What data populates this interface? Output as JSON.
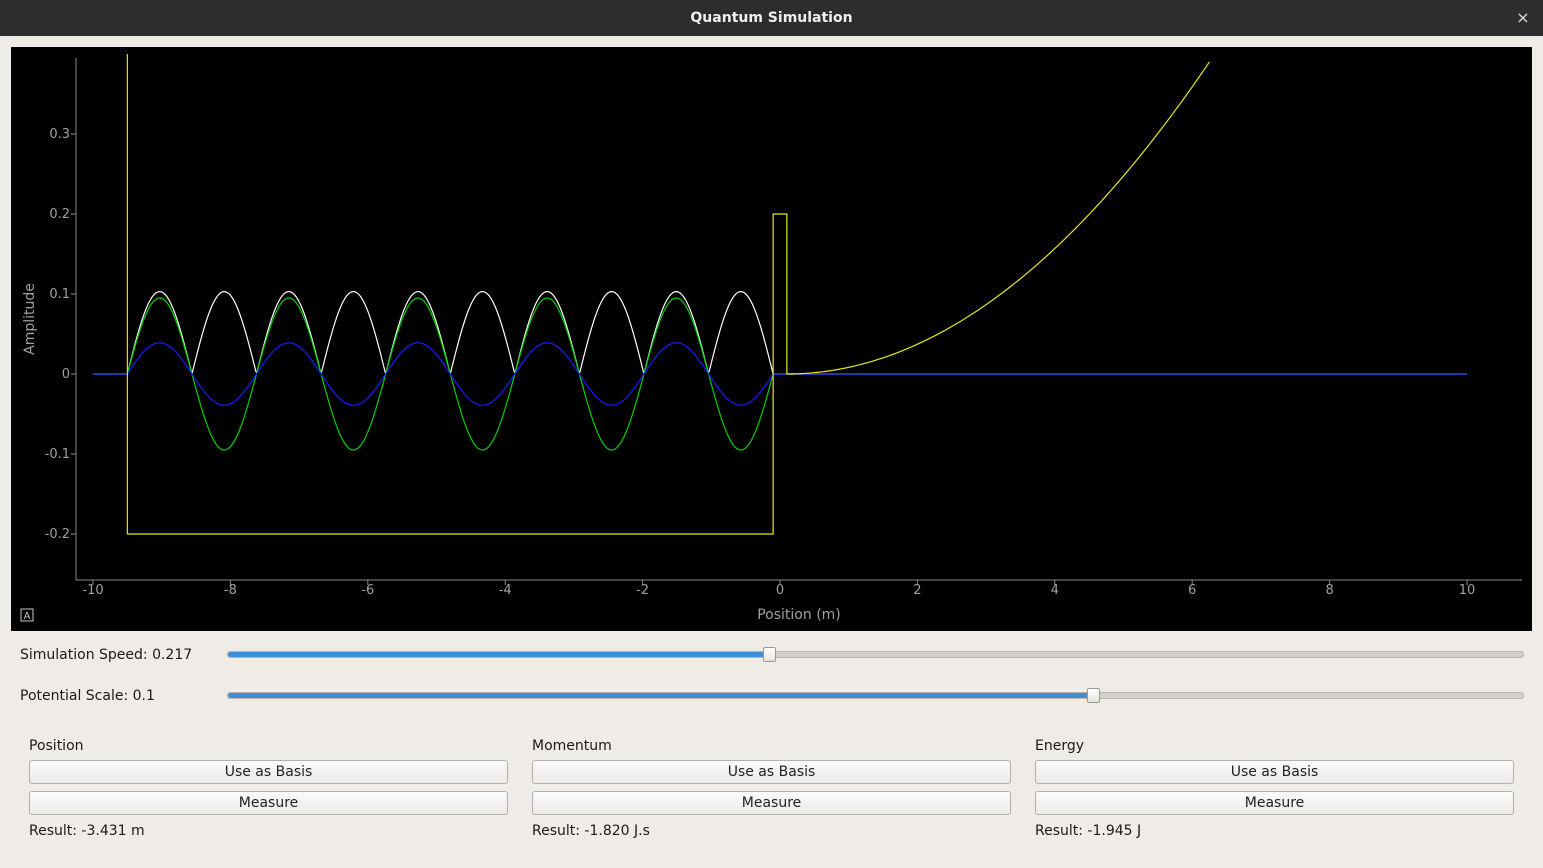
{
  "window": {
    "title": "Quantum Simulation",
    "close_glyph": "×"
  },
  "chart_data": {
    "type": "line",
    "xlabel": "Position (m)",
    "ylabel": "Amplitude",
    "xlim": [
      -10.5,
      11.5
    ],
    "ylim": [
      -0.26,
      0.4
    ],
    "xticks": [
      -10,
      -8,
      -6,
      -4,
      -2,
      0,
      2,
      4,
      6,
      8,
      10
    ],
    "xtick_labels": [
      "-10",
      "-8",
      "-6",
      "-4",
      "-2",
      "0",
      "2",
      "4",
      "6",
      "8",
      "10"
    ],
    "yticks": [
      -0.2,
      -0.1,
      0,
      0.1,
      0.2,
      0.3
    ],
    "ytick_labels": [
      "-0.2",
      "-0.1",
      "0",
      "0.1",
      "0.2",
      "0.3"
    ],
    "grid": false,
    "corner_button_label": "A",
    "series": [
      {
        "key": "magnitude",
        "color": "#ffffff",
        "wave_x_start": -9.5,
        "wave_x_end": -0.1,
        "wave_amplitude": 0.103,
        "wave_half_periods": 10,
        "data_x_start": -10,
        "data_x_end": 10,
        "y_after": 0
      },
      {
        "key": "real",
        "color": "#00d000",
        "wave_x_start": -9.5,
        "wave_x_end": -0.1,
        "wave_amplitude": 0.095,
        "wave_half_periods": 10,
        "data_x_start": -10,
        "data_x_end": 10,
        "y_after": 0,
        "note_sign": "alternating"
      },
      {
        "key": "imag",
        "color": "#1a1aff",
        "wave_x_start": -9.5,
        "wave_x_end": -0.1,
        "wave_amplitude": 0.039,
        "wave_half_periods": 10,
        "data_x_start": -10,
        "data_x_end": 10,
        "y_after": 0,
        "note_sign": "inverse"
      },
      {
        "key": "potential",
        "color": "#e6e61a",
        "well_left_x": -9.5,
        "well_right_x": -0.1,
        "well_bottom": -0.2,
        "wall_top": 0.4,
        "barrier_x_start": -0.1,
        "barrier_x_end": 0.1,
        "barrier_height": 0.2,
        "parabola_start_x": 0.1,
        "parabola_end_x": 6.25,
        "parabola_end_y": 0.39
      }
    ]
  },
  "controls": {
    "speed": {
      "label": "Simulation Speed: 0.217",
      "value": 0.418
    },
    "potential": {
      "label": "Potential Scale: 0.1",
      "value": 0.668
    }
  },
  "groups": [
    {
      "title": "Position",
      "basis_label": "Use as Basis",
      "measure_label": "Measure",
      "result": "Result: -3.431 m"
    },
    {
      "title": "Momentum",
      "basis_label": "Use as Basis",
      "measure_label": "Measure",
      "result": "Result: -1.820 J.s"
    },
    {
      "title": "Energy",
      "basis_label": "Use as Basis",
      "measure_label": "Measure",
      "result": "Result: -1.945 J"
    }
  ]
}
